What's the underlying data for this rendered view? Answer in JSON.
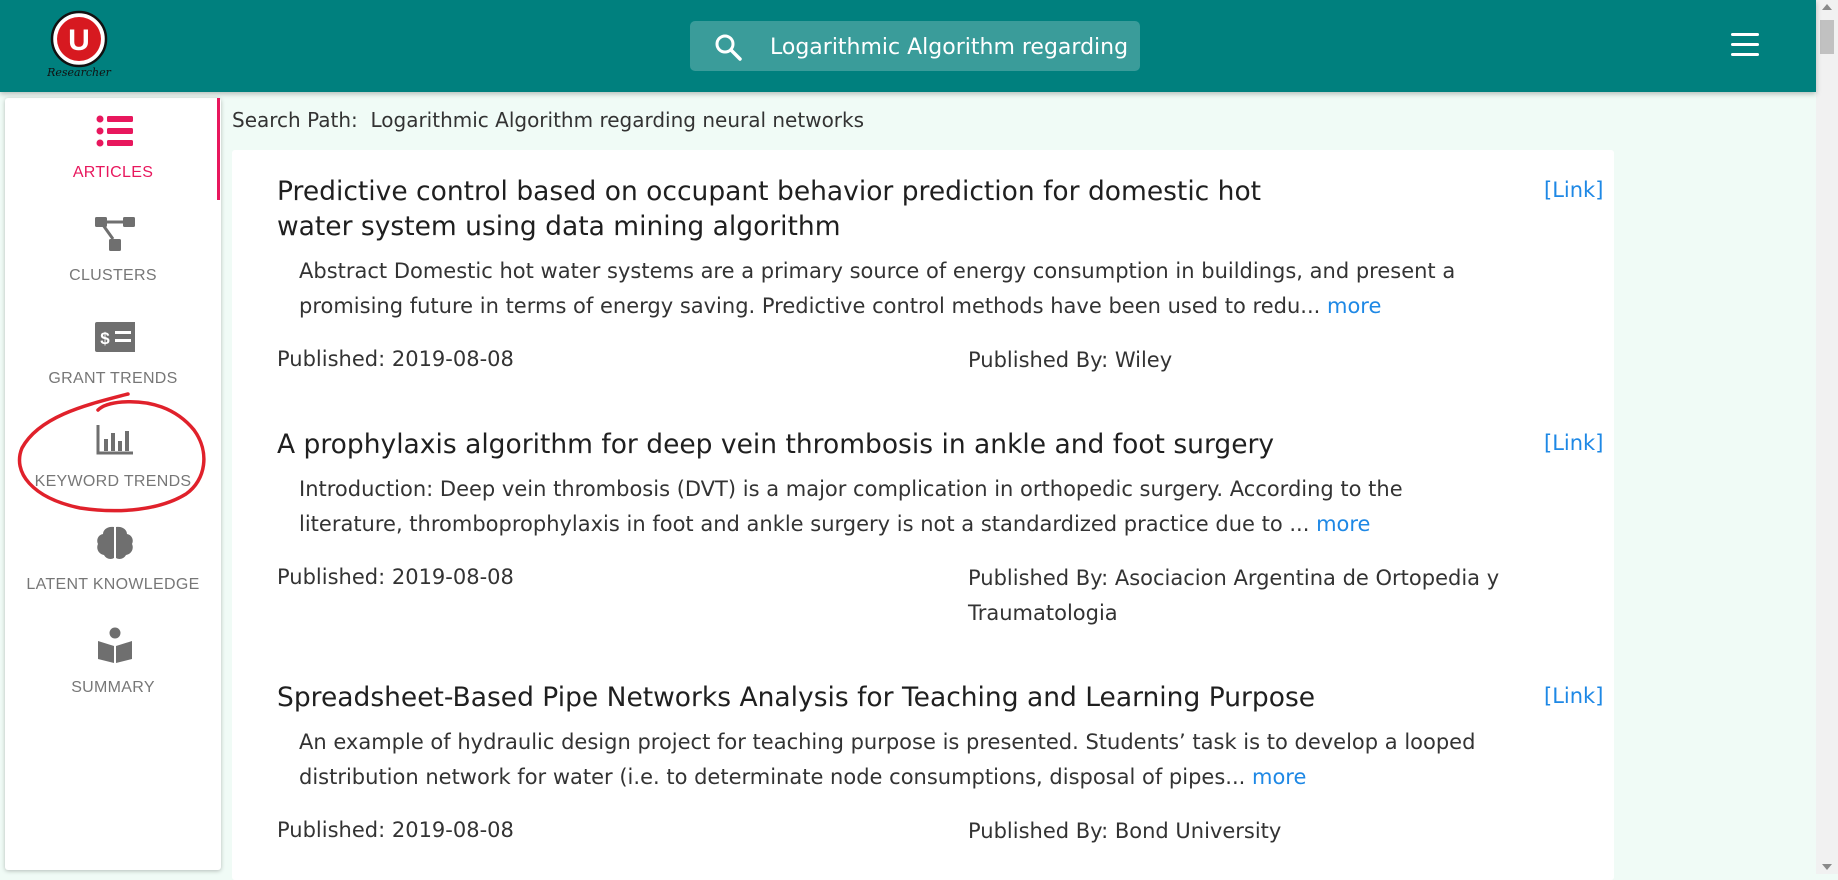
{
  "app": {
    "logo_letter": "U",
    "logo_subtitle": "Researcher"
  },
  "search": {
    "query": "Logarithmic Algorithm regarding ne"
  },
  "sidebar": {
    "items": [
      {
        "label": "ARTICLES",
        "icon": "list-icon",
        "active": true
      },
      {
        "label": "CLUSTERS",
        "icon": "clusters-icon",
        "active": false
      },
      {
        "label": "GRANT TRENDS",
        "icon": "grant-dollar-icon",
        "active": false
      },
      {
        "label": "KEYWORD TRENDS",
        "icon": "bar-chart-icon",
        "active": false
      },
      {
        "label": "LATENT KNOWLEDGE",
        "icon": "brain-icon",
        "active": false
      },
      {
        "label": "SUMMARY",
        "icon": "reader-book-icon",
        "active": false
      }
    ]
  },
  "breadcrumb": {
    "label": "Search Path:",
    "value": "Logarithmic Algorithm regarding neural networks"
  },
  "articles": [
    {
      "title": "Predictive control based on occupant behavior prediction for domestic hot water system using data mining algorithm",
      "link": "[Link]",
      "abstract": "Abstract Domestic hot water systems are a primary source of energy consumption in buildings, and present a promising future in terms of energy saving. Predictive control methods have been used to redu...",
      "more": "more",
      "published": "Published: 2019-08-08",
      "publisher": "Published By: Wiley"
    },
    {
      "title": "A prophylaxis algorithm for deep vein thrombosis in ankle and foot surgery",
      "link": "[Link]",
      "abstract": "Introduction: Deep vein thrombosis (DVT) is a major complication in orthopedic surgery. According to the literature, thromboprophylaxis in foot and ankle surgery is not a standardized practice due to ...",
      "more": "more",
      "published": "Published: 2019-08-08",
      "publisher": "Published By: Asociacion Argentina de Ortopedia y Traumatologia"
    },
    {
      "title": "Spreadsheet-Based Pipe Networks Analysis for Teaching and Learning Purpose",
      "link": "[Link]",
      "abstract": "An example of hydraulic design project for teaching purpose is presented. Students’ task is to develop a looped distribution network for water (i.e. to determinate node consumptions, disposal of pipes...",
      "more": "more",
      "published": "Published: 2019-08-08",
      "publisher": "Published By: Bond University"
    }
  ],
  "colors": {
    "header": "#00807e",
    "active": "#e8175d",
    "link": "#1e88e5",
    "annotation": "#e0212b",
    "background": "#f0fbf6"
  }
}
